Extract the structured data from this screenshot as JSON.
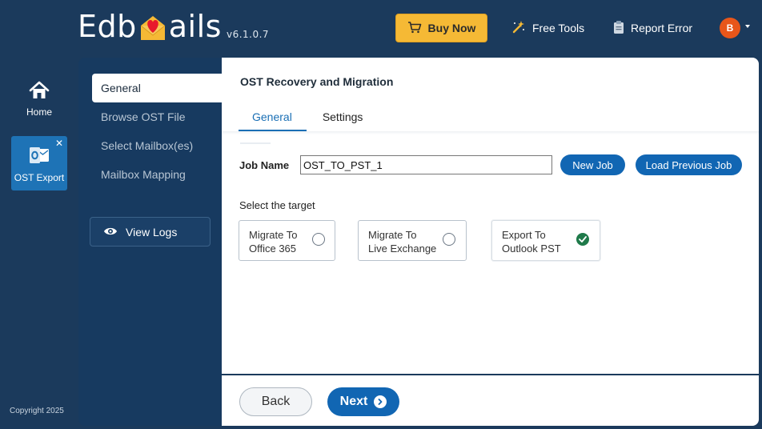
{
  "brand": {
    "name_prefix": "Edb",
    "name_suffix": "ails",
    "version": "v6.1.0.7",
    "logo_color": "#e8192c"
  },
  "topbar": {
    "buy_label": "Buy Now",
    "free_tools_label": "Free Tools",
    "report_error_label": "Report Error",
    "avatar_initial": "B"
  },
  "rail": {
    "home_label": "Home",
    "app_label": "OST Export",
    "app_close": "✕",
    "copyright": "Copyright 2025"
  },
  "steps": {
    "items": [
      {
        "label": "General",
        "active": true
      },
      {
        "label": "Browse OST File",
        "active": false
      },
      {
        "label": "Select Mailbox(es)",
        "active": false
      },
      {
        "label": "Mailbox Mapping",
        "active": false
      }
    ],
    "view_logs_label": "View Logs"
  },
  "main": {
    "title": "OST Recovery and Migration",
    "tabs": [
      {
        "label": "General",
        "active": true
      },
      {
        "label": "Settings",
        "active": false
      }
    ],
    "job_name_label": "Job Name",
    "job_name_value": "OST_TO_PST_1",
    "new_job_label": "New Job",
    "load_previous_label": "Load Previous Job",
    "target_label": "Select the target",
    "targets": [
      {
        "line1": "Migrate To",
        "line2": "Office 365",
        "selected": false
      },
      {
        "line1": "Migrate To",
        "line2": "Live Exchange",
        "selected": false
      },
      {
        "line1": "Export To",
        "line2": "Outlook PST",
        "selected": true
      }
    ]
  },
  "footer": {
    "back_label": "Back",
    "next_label": "Next"
  },
  "colors": {
    "background": "#1b3a5c",
    "accent": "#1166b3",
    "buy": "#f5b935",
    "selected_radio": "#1f7a4a",
    "avatar": "#e8561a"
  }
}
